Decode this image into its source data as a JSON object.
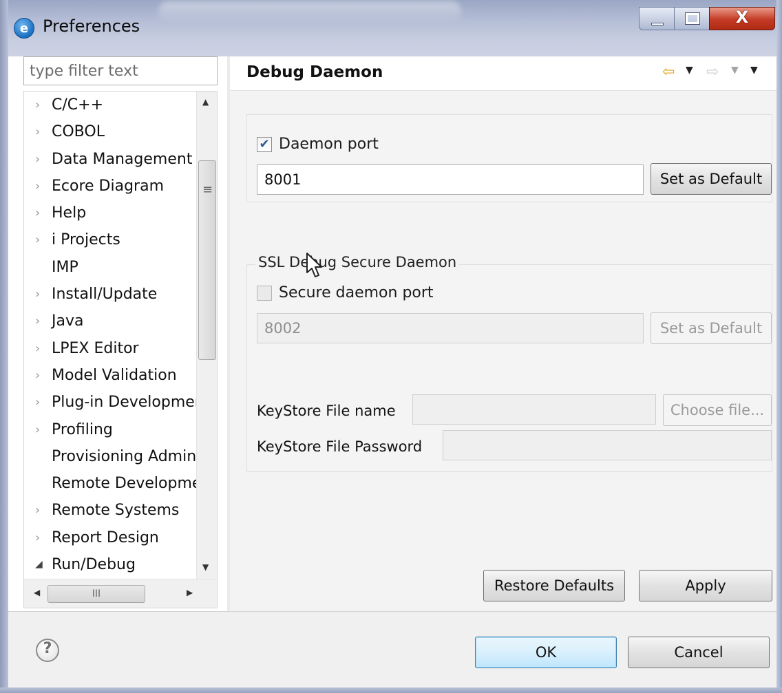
{
  "window": {
    "title": "Preferences",
    "app_icon_glyph": "e",
    "close_glyph": "X"
  },
  "sidebar": {
    "filter_placeholder": "type filter text",
    "items": [
      {
        "label": "C/C++",
        "arrow": "›"
      },
      {
        "label": "COBOL",
        "arrow": "›"
      },
      {
        "label": "Data Management",
        "arrow": "›"
      },
      {
        "label": "Ecore Diagram",
        "arrow": "›"
      },
      {
        "label": "Help",
        "arrow": "›"
      },
      {
        "label": "i Projects",
        "arrow": "›"
      },
      {
        "label": "IMP",
        "arrow": ""
      },
      {
        "label": "Install/Update",
        "arrow": "›"
      },
      {
        "label": "Java",
        "arrow": "›"
      },
      {
        "label": "LPEX Editor",
        "arrow": "›"
      },
      {
        "label": "Model Validation",
        "arrow": "›"
      },
      {
        "label": "Plug-in Development",
        "arrow": "›"
      },
      {
        "label": "Profiling",
        "arrow": "›"
      },
      {
        "label": "Provisioning Admin",
        "arrow": ""
      },
      {
        "label": "Remote Development",
        "arrow": ""
      },
      {
        "label": "Remote Systems",
        "arrow": "›"
      },
      {
        "label": "Report Design",
        "arrow": "›"
      },
      {
        "label": "Run/Debug",
        "arrow": "◢"
      }
    ],
    "vscroll_grip": "≡",
    "hscroll_grip": "III"
  },
  "page": {
    "title": "Debug Daemon",
    "daemon": {
      "checkbox_label": "Daemon port",
      "checked": true,
      "port_value": "8001",
      "set_default_label": "Set as Default"
    },
    "ssl": {
      "group_title": "SSL Debug Secure Daemon",
      "checkbox_label": "Secure daemon port",
      "checked": false,
      "port_value": "8002",
      "set_default_label": "Set as Default",
      "keystore_name_label": "KeyStore File name",
      "keystore_name_value": "",
      "choose_file_label": "Choose file...",
      "keystore_password_label": "KeyStore File Password",
      "keystore_password_value": ""
    },
    "restore_defaults_label": "Restore Defaults",
    "apply_label": "Apply"
  },
  "footer": {
    "help_glyph": "?",
    "ok_label": "OK",
    "cancel_label": "Cancel"
  },
  "colors": {
    "titlebar": "#b4bdd6",
    "close_button": "#c43b25",
    "page_background": "#f3f3f3",
    "default_button_border": "#3c7fb1",
    "nav_back_arrow": "#e2a520"
  },
  "icons": {
    "app": "eclipse-icon",
    "nav_back": "arrow-left-icon",
    "nav_forward": "arrow-right-icon",
    "view_menu": "chevron-down-icon",
    "help": "help-icon"
  }
}
